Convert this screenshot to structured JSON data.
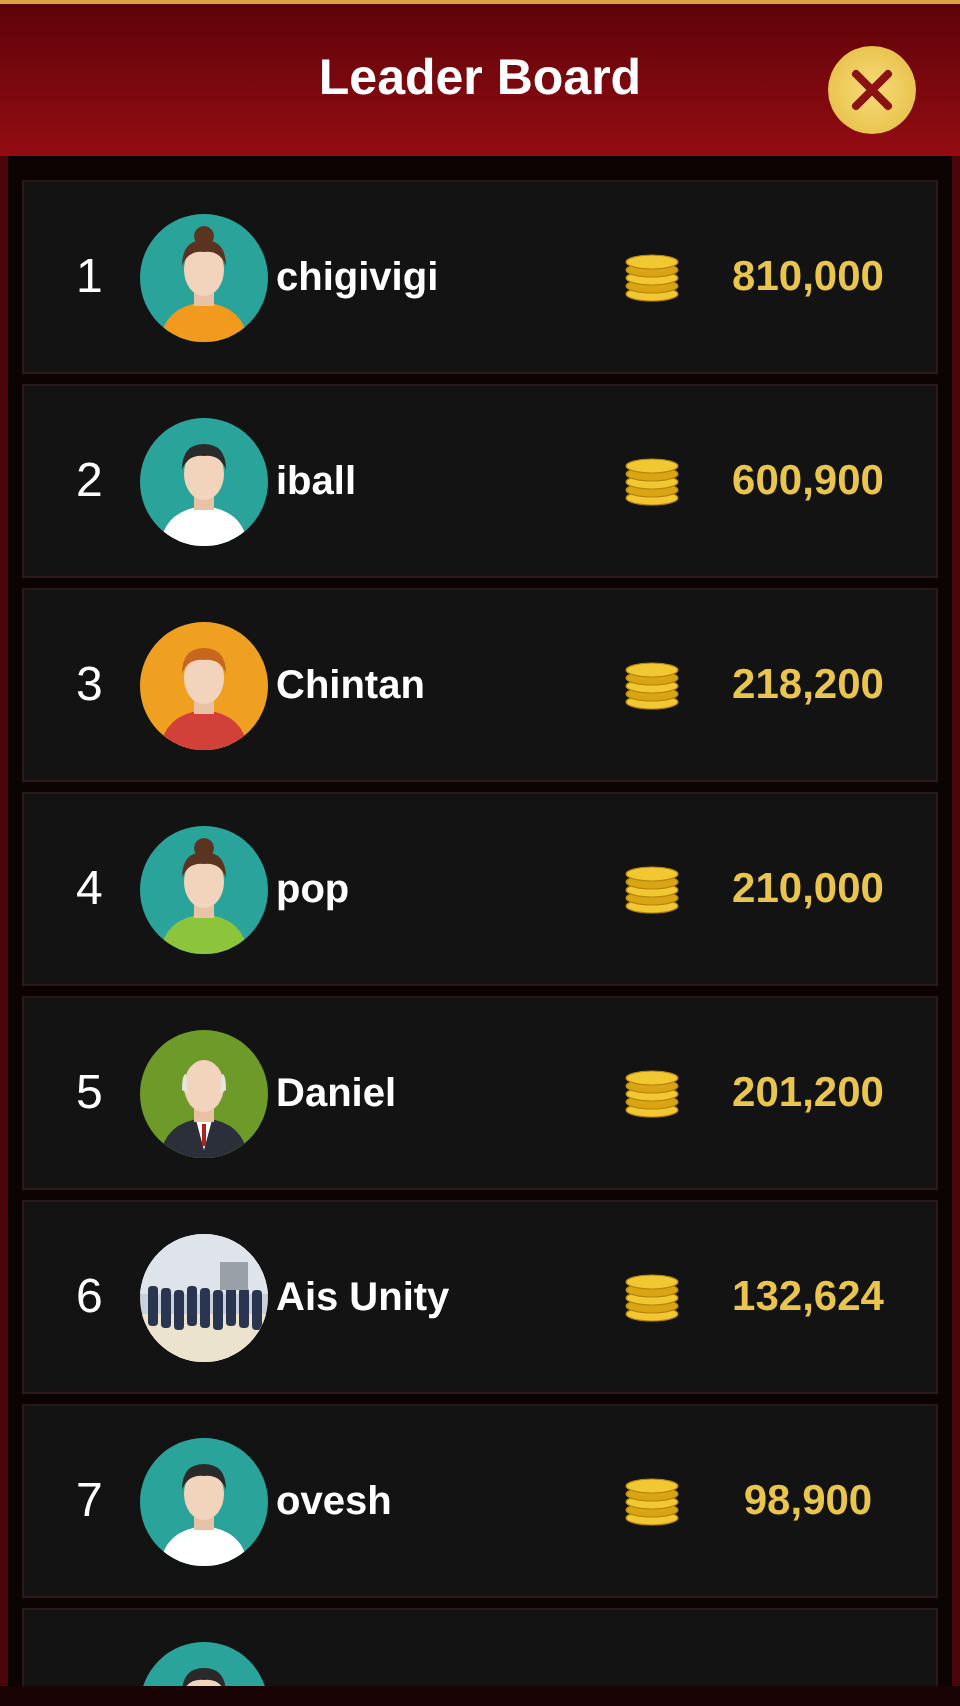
{
  "header": {
    "title": "Leader Board"
  },
  "players": [
    {
      "rank": "1",
      "name": "chigivigi",
      "score": "810,000",
      "avatar": {
        "kind": "girl",
        "color": "#2aa39a"
      }
    },
    {
      "rank": "2",
      "name": "iball",
      "score": "600,900",
      "avatar": {
        "kind": "man",
        "color": "#2aa39a"
      }
    },
    {
      "rank": "3",
      "name": "Chintan",
      "score": "218,200",
      "avatar": {
        "kind": "boy",
        "color": "#f0a020"
      }
    },
    {
      "rank": "4",
      "name": "pop",
      "score": "210,000",
      "avatar": {
        "kind": "lady",
        "color": "#2aa39a"
      }
    },
    {
      "rank": "5",
      "name": "Daniel",
      "score": "201,200",
      "avatar": {
        "kind": "elder",
        "color": "#6e9a2a"
      }
    },
    {
      "rank": "6",
      "name": "Ais Unity",
      "score": "132,624"
    },
    {
      "rank": "7",
      "name": "ovesh",
      "score": "98,900",
      "avatar": {
        "kind": "man",
        "color": "#2aa39a"
      }
    },
    {
      "avatar": {
        "kind": "man",
        "color": "#2aa39a"
      }
    }
  ]
}
